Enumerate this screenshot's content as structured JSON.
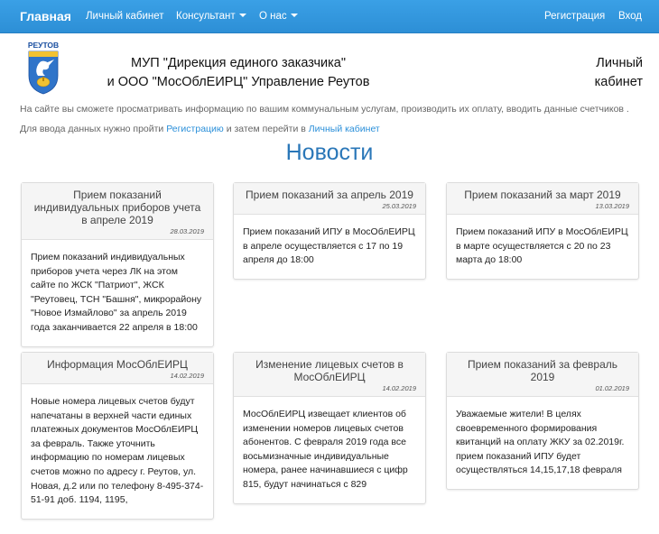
{
  "navbar": {
    "brand": "Главная",
    "items": [
      "Личный кабинет",
      "Консультант",
      "О нас"
    ],
    "right": [
      "Регистрация",
      "Вход"
    ]
  },
  "logo": {
    "text": "РЕУТОВ"
  },
  "header": {
    "org_line1": "МУП \"Дирекция единого заказчика\"",
    "org_line2": "и ООО \"МосОблЕИРЦ\" Управление Реутов",
    "cabinet_line1": "Личный",
    "cabinet_line2": "кабинет"
  },
  "info": {
    "line1": "На сайте вы сможете просматривать информацию по вашим коммунальным услугам, производить их оплату, вводить данные счетчиков .",
    "line2_pre": "Для ввода данных нужно пройти ",
    "line2_link1": "Регистрацию",
    "line2_mid": " и затем перейти в ",
    "line2_link2": "Личный кабинет"
  },
  "news_title": "Новости",
  "news": [
    {
      "title": "Прием показаний индивидуальных приборов учета в апреле 2019",
      "date": "28.03.2019",
      "body": "Прием показаний индивидуальных приборов учета через ЛК на этом сайте по ЖСК \"Патриот\", ЖСК \"Реутовец, ТСН \"Башня\", микрорайону \"Новое Измайлово\" за апрель 2019 года заканчивается 22 апреля в 18:00"
    },
    {
      "title": "Прием показаний за апрель 2019",
      "date": "25.03.2019",
      "body": "Прием показаний ИПУ в МосОблЕИРЦ в апреле осуществляется с 17 по 19 апреля до 18:00"
    },
    {
      "title": "Прием показаний за март 2019",
      "date": "13.03.2019",
      "body": "Прием показаний ИПУ в МосОблЕИРЦ в марте осуществляется с 20 по 23 марта до 18:00"
    },
    {
      "title": "Информация МосОблЕИРЦ",
      "date": "14.02.2019",
      "body": "Новые номера лицевых счетов будут напечатаны в верхней части единых платежных документов МосОблЕИРЦ за февраль. Также уточнить информацию по номерам лицевых счетов можно по адресу г. Реутов, ул. Новая, д.2 или по телефону 8-495-374-51-91 доб. 1194, 1195,"
    },
    {
      "title": "Изменение лицевых счетов в МосОблЕИРЦ",
      "date": "14.02.2019",
      "body": "МосОблЕИРЦ извещает клиентов об изменении номеров лицевых счетов абонентов. С февраля 2019 года все восьмизначные индивидуальные номера, ранее начинавшиеся с цифр 815, будут начинаться с 829"
    },
    {
      "title": "Прием показаний за февраль 2019",
      "date": "01.02.2019",
      "body": "Уважаемые жители! В целях своевременного формирования квитанций на оплату ЖКУ за 02.2019г. прием показаний ИПУ будет осуществляться 14,15,17,18 февраля"
    }
  ]
}
